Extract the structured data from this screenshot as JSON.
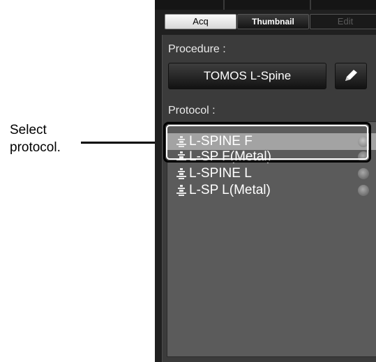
{
  "annotation": {
    "line1": "Select",
    "line2": "protocol."
  },
  "tabs": [
    {
      "label": "Acq",
      "state": "active"
    },
    {
      "label": "Thumbnail",
      "state": "normal"
    },
    {
      "label": "Edit",
      "state": "disabled"
    }
  ],
  "procedure": {
    "label": "Procedure :",
    "value": "TOMOS L-Spine",
    "edit_icon": "pencil-icon"
  },
  "protocol": {
    "label": "Protocol :",
    "items": [
      {
        "name": "L-SPINE F",
        "icon": "spine-icon",
        "status_icon": "status-dot-icon",
        "selected": true
      },
      {
        "name": "L-SP F(Metal)",
        "icon": "spine-icon",
        "status_icon": "status-dot-icon",
        "selected": false
      },
      {
        "name": "L-SPINE L",
        "icon": "spine-icon",
        "status_icon": "status-dot-icon",
        "selected": false
      },
      {
        "name": "L-SP L(Metal)",
        "icon": "spine-icon",
        "status_icon": "status-dot-icon",
        "selected": false
      }
    ]
  },
  "colors": {
    "panel": "#202020",
    "list": "#5b5b5b",
    "selection": "#a3a3a3"
  }
}
